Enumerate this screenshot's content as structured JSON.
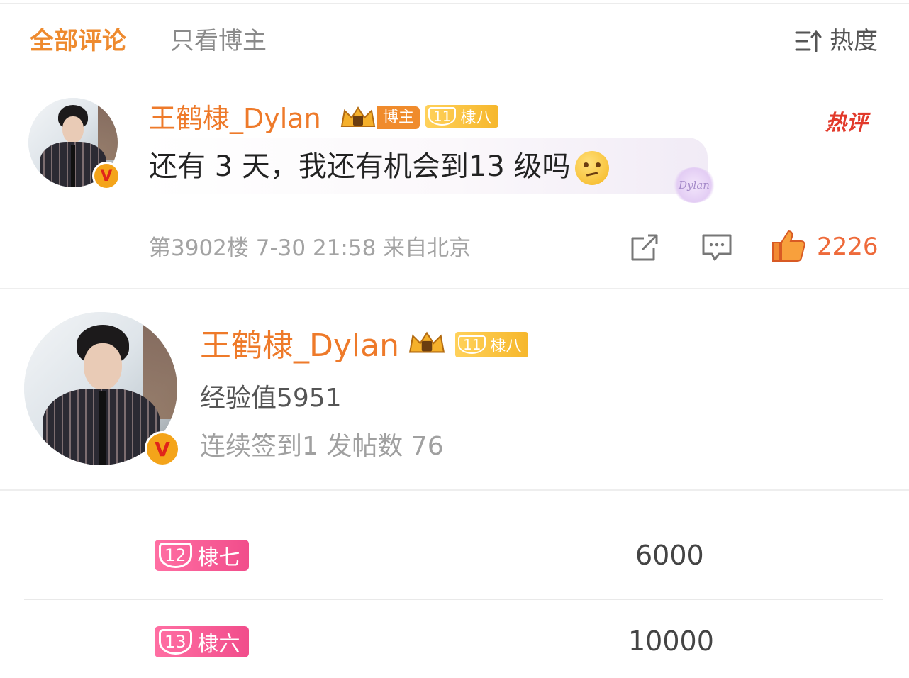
{
  "tabs": {
    "all_comments": "全部评论",
    "author_only": "只看博主"
  },
  "sort": {
    "label": "热度",
    "icon": "sort-icon"
  },
  "comment": {
    "username": "王鹤棣_Dylan",
    "author_tag": "博主",
    "fan_level": {
      "number": "11",
      "title": "棣八"
    },
    "hot_label": "热评",
    "text": "还有 3 天，我还有机会到13 级吗",
    "bubble_decoration": "Dylan",
    "floor": "第3902楼",
    "time": "7-30 21:58",
    "location": "来自北京",
    "like_count": "2226"
  },
  "profile": {
    "username": "王鹤棣_Dylan",
    "fan_level": {
      "number": "11",
      "title": "棣八"
    },
    "experience": "经验值5951",
    "stats": "连续签到1 发帖数 76"
  },
  "levels": [
    {
      "number": "12",
      "title": "棣七",
      "points": "6000"
    },
    {
      "number": "13",
      "title": "棣六",
      "points": "10000"
    }
  ],
  "colors": {
    "accent": "#ee7a2a",
    "like": "#ee6a3a",
    "hot": "#e23a2b",
    "level_gold": "#f6b72c",
    "level_pink": "#f14d8b"
  }
}
